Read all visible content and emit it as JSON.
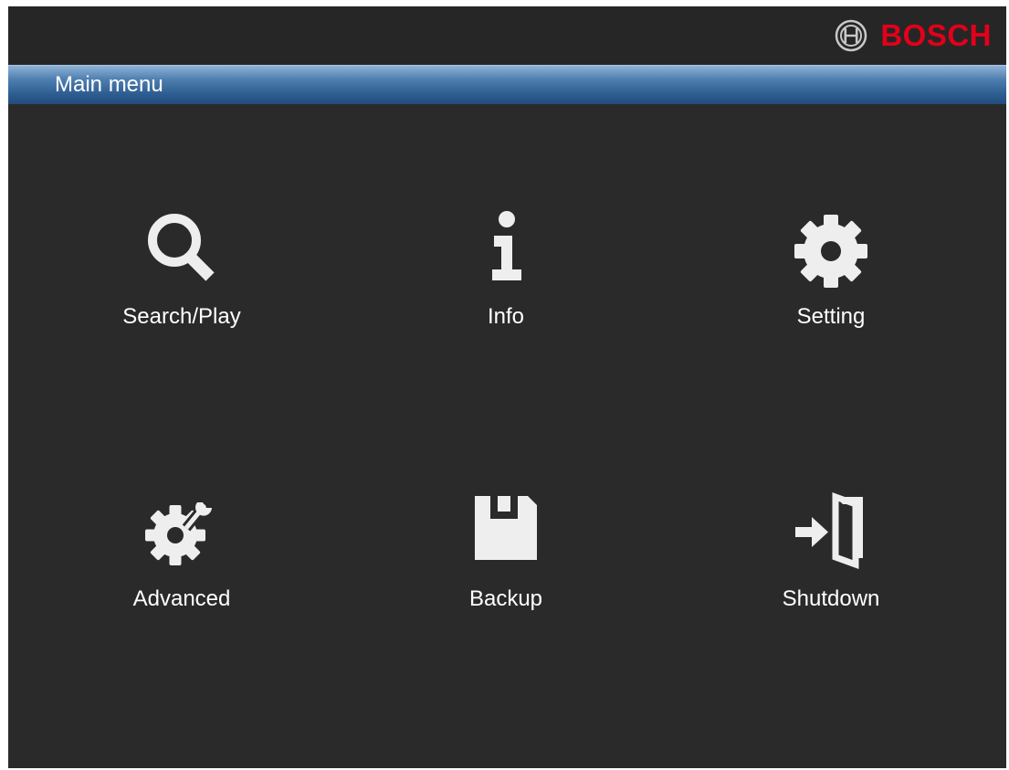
{
  "brand": {
    "name": "BOSCH",
    "color": "#e2001a"
  },
  "window": {
    "title": "Main menu",
    "title_bar_color": "#2d5c90",
    "background_color": "#2a2a2a"
  },
  "menu": {
    "items": [
      {
        "label": "Search/Play",
        "icon": "search-icon"
      },
      {
        "label": "Info",
        "icon": "info-icon"
      },
      {
        "label": "Setting",
        "icon": "gear-icon"
      },
      {
        "label": "Advanced",
        "icon": "gear-wrench-icon"
      },
      {
        "label": "Backup",
        "icon": "floppy-disk-icon"
      },
      {
        "label": "Shutdown",
        "icon": "exit-door-icon"
      }
    ]
  }
}
